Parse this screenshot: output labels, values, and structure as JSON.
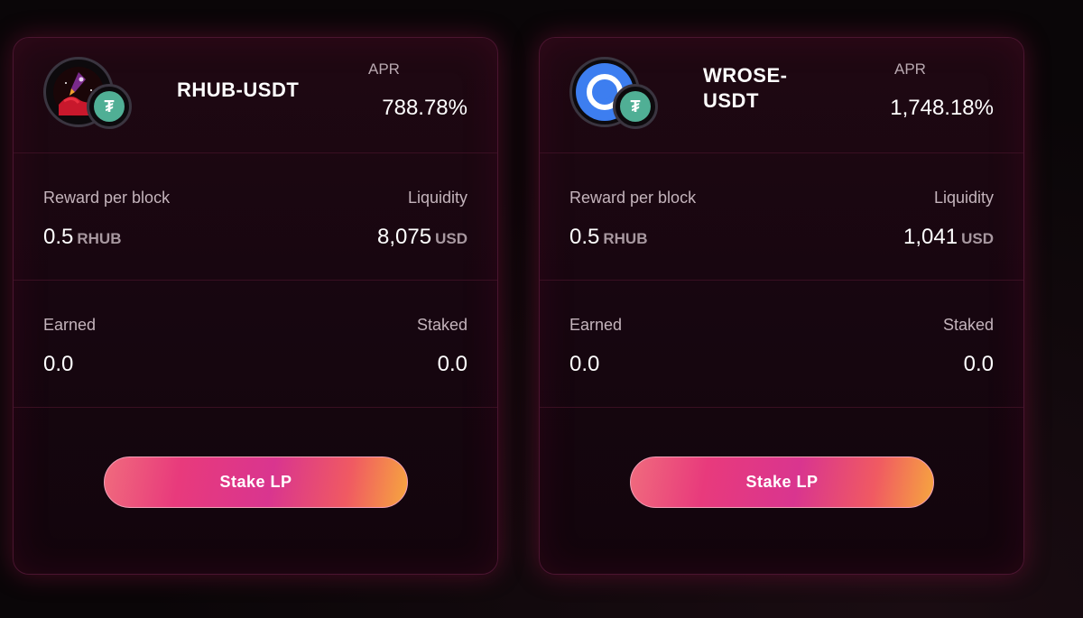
{
  "cards": [
    {
      "pair": "RHUB-USDT",
      "token_icon": "rhub-rocket-icon",
      "quote_icon": "tether-icon",
      "apr_label": "APR",
      "apr_value": "788.78%",
      "reward_label": "Reward per block",
      "reward_value": "0.5",
      "reward_unit": "RHUB",
      "liquidity_label": "Liquidity",
      "liquidity_value": "8,075",
      "liquidity_unit": "USD",
      "earned_label": "Earned",
      "earned_value": "0.0",
      "staked_label": "Staked",
      "staked_value": "0.0",
      "button_label": "Stake LP"
    },
    {
      "pair": "WROSE-USDT",
      "pair_line1": "WROSE-",
      "pair_line2": "USDT",
      "token_icon": "oasis-rose-icon",
      "quote_icon": "tether-icon",
      "apr_label": "APR",
      "apr_value": "1,748.18%",
      "reward_label": "Reward per block",
      "reward_value": "0.5",
      "reward_unit": "RHUB",
      "liquidity_label": "Liquidity",
      "liquidity_value": "1,041",
      "liquidity_unit": "USD",
      "earned_label": "Earned",
      "earned_value": "0.0",
      "staked_label": "Staked",
      "staked_value": "0.0",
      "button_label": "Stake LP"
    }
  ],
  "colors": {
    "background": "#0a0608",
    "card_border": "#4a1530",
    "tether_green": "#50af95",
    "button_gradient_start": "#f06b7d",
    "button_gradient_end": "#f6a63f"
  }
}
